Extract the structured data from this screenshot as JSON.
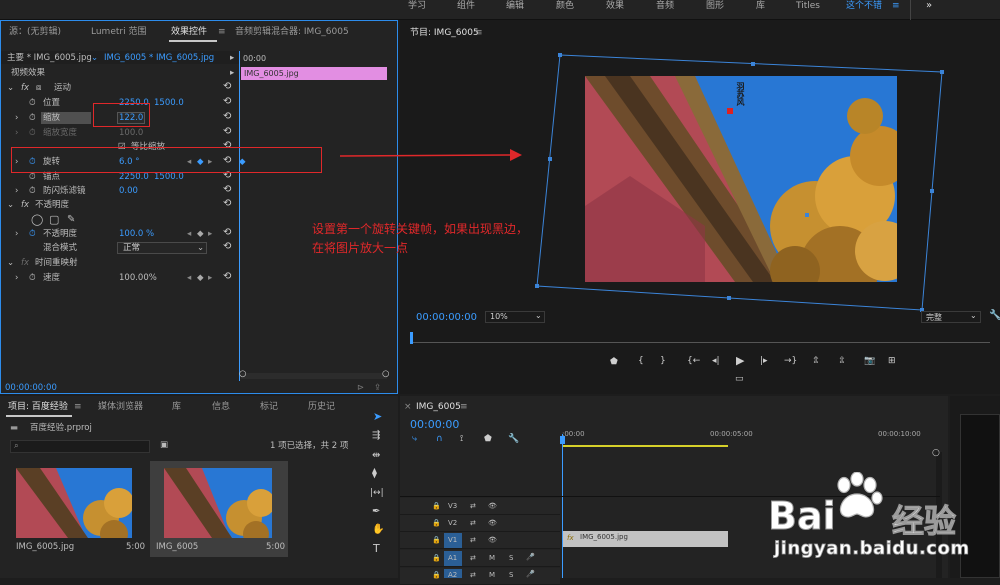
{
  "workspace": {
    "tabs": [
      "学习",
      "组件",
      "编辑",
      "颜色",
      "效果",
      "音频",
      "图形",
      "库",
      "Titles",
      "这个不错"
    ],
    "menu_icon": "hamburger-icon",
    "more_icon": "double-chevron-right-icon"
  },
  "effect_controls": {
    "tabs": [
      "源：(无剪辑)",
      "Lumetri 范围",
      "效果控件",
      "音频剪辑混合器: IMG_6005"
    ],
    "menu_icon": "hamburger-icon",
    "master_label": "主要 * IMG_6005.jpg",
    "clip_label": "IMG_6005 * IMG_6005.jpg",
    "mini_time": "00:00",
    "clip_name": "IMG_6005.jpg",
    "section_video": "视频效果",
    "motion": "运动",
    "position_label": "位置",
    "position_x": "2250.0",
    "position_y": "1500.0",
    "scale_label": "缩放",
    "scale_value": "122.0",
    "scale_width_label": "缩放宽度",
    "scale_width_value": "100.0",
    "uniform_label": "等比缩放",
    "rotation_label": "旋转",
    "rotation_value": "6.0 °",
    "anchor_label": "锚点",
    "anchor_x": "2250.0",
    "anchor_y": "1500.0",
    "antiflicker_label": "防闪烁滤镜",
    "antiflicker_value": "0.00",
    "opacity_section": "不透明度",
    "opacity_label": "不透明度",
    "opacity_value": "100.0 %",
    "blend_label": "混合模式",
    "blend_value": "正常",
    "time_remap": "时间重映射",
    "speed_label": "速度",
    "speed_value": "100.00%",
    "timecode": "00:00:00:00"
  },
  "program": {
    "title": "节目: IMG_6005",
    "timecode": "00:00:00:00",
    "zoom": "10%",
    "quality": "完整",
    "watermark": "羽苏风"
  },
  "annotation": {
    "text_line1": "设置第一个旋转关键帧，如果出现黑边，",
    "text_line2": "在将图片放大一点"
  },
  "project": {
    "tabs": [
      "项目: 百度经验",
      "媒体浏览器",
      "库",
      "信息",
      "标记",
      "历史记"
    ],
    "file": "百度经验.prproj",
    "status": "1 项已选择，共 2 项",
    "items": [
      {
        "name": "IMG_6005.jpg",
        "duration": "5:00"
      },
      {
        "name": "IMG_6005",
        "duration": "5:00"
      }
    ]
  },
  "timeline": {
    "title": "IMG_6005",
    "timecode": "00:00:00",
    "ruler": [
      ":00:00",
      "00:00:05:00",
      "00:00:10:00"
    ],
    "tracks": [
      "V3",
      "V2",
      "V1",
      "A1",
      "A2"
    ],
    "m_label": "M",
    "s_label": "S",
    "clip_name": "IMG_6005.jpg"
  },
  "watermark": {
    "brand_left": "Bai",
    "brand_right": "经验",
    "url": "jingyan.baidu.com"
  }
}
